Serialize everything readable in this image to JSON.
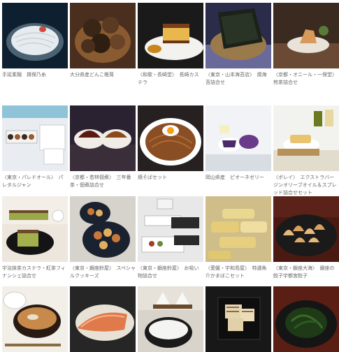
{
  "items": [
    {
      "caption": "手延素麺　揖保乃糸"
    },
    {
      "caption": "大分県産どんこ椎茸"
    },
    {
      "caption": "〈和歌・長崎堂〉　長崎カステラ"
    },
    {
      "caption": "〈東京・山本海苔店〉　焼海苔詰合せ"
    },
    {
      "caption": "〈京都・オニール・一保堂〉　煎茶詰合せ"
    },
    {
      "caption": "〈東京・パレドオール〉　パレタルジャン"
    },
    {
      "caption": "〈京都・若林佃煮〉　三年番茶・佃煮詰合せ"
    },
    {
      "caption": "焼そばセット"
    },
    {
      "caption": "岡山県産　ピオーネゼリー"
    },
    {
      "caption": "〈ボレイ〉　エクストラバージンオリーブオイル＆スプレッド詰合せセット"
    },
    {
      "caption": "宇治抹茶カステラ・紅茶フィナンシェ詰合せ"
    },
    {
      "caption": "〈東京・銀座鈴屋〉　スペシャルクッキーズ"
    },
    {
      "caption": "〈東京・銀座鈴屋〉　お吸い物詰合せ"
    },
    {
      "caption": "〈愛媛・宇和島屋〉　特選魚介かまぼこセット"
    },
    {
      "caption": "〈東京・銀座大海〉　銀座の餃子宇都宮餃子"
    },
    {
      "caption": ""
    },
    {
      "caption": ""
    },
    {
      "caption": ""
    },
    {
      "caption": ""
    },
    {
      "caption": ""
    }
  ]
}
